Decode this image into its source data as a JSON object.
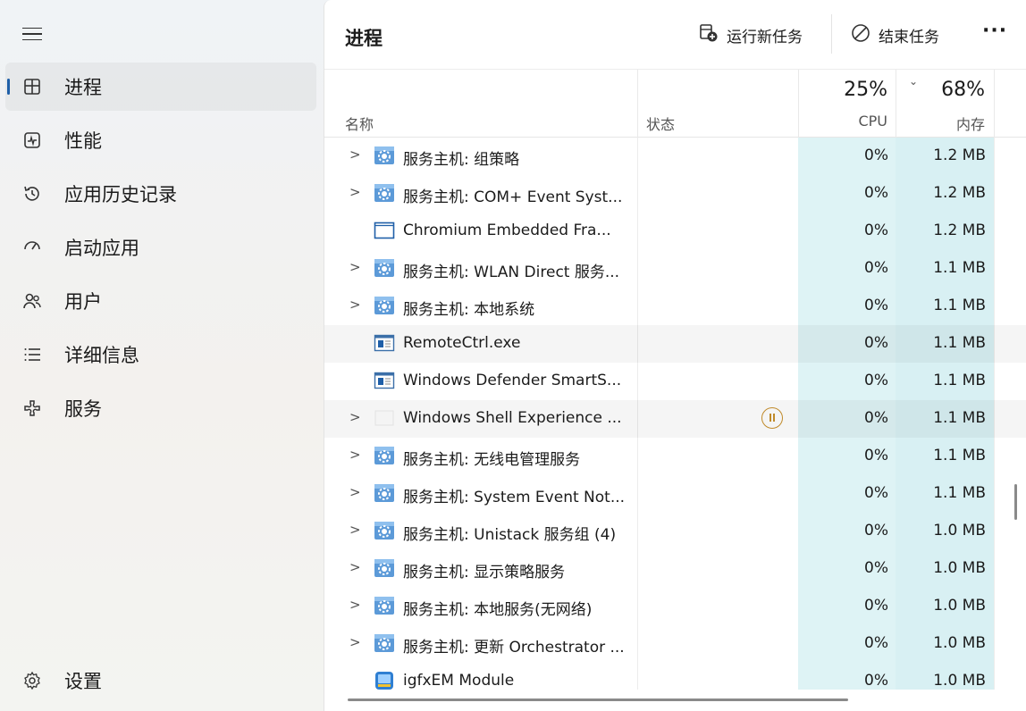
{
  "sidebar": {
    "items": [
      {
        "label": "进程",
        "icon": "processes-icon"
      },
      {
        "label": "性能",
        "icon": "performance-icon"
      },
      {
        "label": "应用历史记录",
        "icon": "history-icon"
      },
      {
        "label": "启动应用",
        "icon": "startup-icon"
      },
      {
        "label": "用户",
        "icon": "users-icon"
      },
      {
        "label": "详细信息",
        "icon": "details-icon"
      },
      {
        "label": "服务",
        "icon": "services-icon"
      }
    ],
    "settings_label": "设置"
  },
  "toolbar": {
    "title": "进程",
    "run_task_label": "运行新任务",
    "end_task_label": "结束任务",
    "more_label": "···"
  },
  "header": {
    "name": "名称",
    "status": "状态",
    "cpu_pct": "25%",
    "cpu_label": "CPU",
    "mem_pct": "68%",
    "mem_label": "内存"
  },
  "rows": [
    {
      "expand": ">",
      "icon": "gear",
      "name": "服务主机: 组策略",
      "cpu": "0%",
      "mem": "1.2 MB"
    },
    {
      "expand": ">",
      "icon": "gear",
      "name": "服务主机: COM+ Event Syst...",
      "cpu": "0%",
      "mem": "1.2 MB"
    },
    {
      "expand": "",
      "icon": "window",
      "name": "Chromium Embedded Fra...",
      "cpu": "0%",
      "mem": "1.2 MB"
    },
    {
      "expand": ">",
      "icon": "gear",
      "name": "服务主机: WLAN Direct 服务...",
      "cpu": "0%",
      "mem": "1.1 MB"
    },
    {
      "expand": ">",
      "icon": "gear",
      "name": "服务主机: 本地系统",
      "cpu": "0%",
      "mem": "1.1 MB"
    },
    {
      "expand": "",
      "icon": "app",
      "name": "RemoteCtrl.exe",
      "cpu": "0%",
      "mem": "1.1 MB",
      "hover": true
    },
    {
      "expand": "",
      "icon": "app",
      "name": "Windows Defender SmartS...",
      "cpu": "0%",
      "mem": "1.1 MB"
    },
    {
      "expand": ">",
      "icon": "blank",
      "name": "Windows Shell Experience ...",
      "cpu": "0%",
      "mem": "1.1 MB",
      "hover": true,
      "paused": true
    },
    {
      "expand": ">",
      "icon": "gear",
      "name": "服务主机: 无线电管理服务",
      "cpu": "0%",
      "mem": "1.1 MB"
    },
    {
      "expand": ">",
      "icon": "gear",
      "name": "服务主机: System Event Not...",
      "cpu": "0%",
      "mem": "1.1 MB"
    },
    {
      "expand": ">",
      "icon": "gear",
      "name": "服务主机: Unistack 服务组 (4)",
      "cpu": "0%",
      "mem": "1.0 MB"
    },
    {
      "expand": ">",
      "icon": "gear",
      "name": "服务主机: 显示策略服务",
      "cpu": "0%",
      "mem": "1.0 MB"
    },
    {
      "expand": ">",
      "icon": "gear",
      "name": "服务主机: 本地服务(无网络)",
      "cpu": "0%",
      "mem": "1.0 MB"
    },
    {
      "expand": ">",
      "icon": "gear",
      "name": "服务主机: 更新 Orchestrator ...",
      "cpu": "0%",
      "mem": "1.0 MB"
    },
    {
      "expand": "",
      "icon": "igfx",
      "name": "igfxEM Module",
      "cpu": "0%",
      "mem": "1.0 MB"
    }
  ],
  "colors": {
    "accent": "#1f5fa8",
    "cpu_column": "#def3f5",
    "mem_column": "#d8f0f3",
    "paused": "#c08a2a"
  }
}
